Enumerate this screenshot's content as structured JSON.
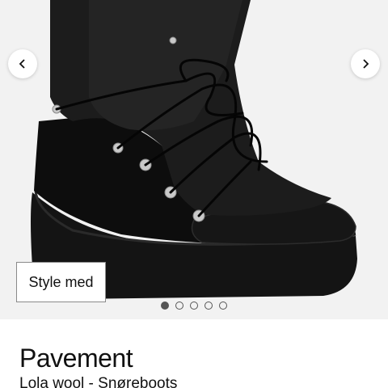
{
  "gallery": {
    "image_alt": "Lola wool - Snøreboots",
    "prev_icon": "chevron-left-icon",
    "next_icon": "chevron-right-icon",
    "style_button_label": "Style med",
    "dots_total": 5,
    "dots_active": 1
  },
  "product": {
    "brand": "Pavement",
    "name": "Lola wool - Snøreboots"
  }
}
